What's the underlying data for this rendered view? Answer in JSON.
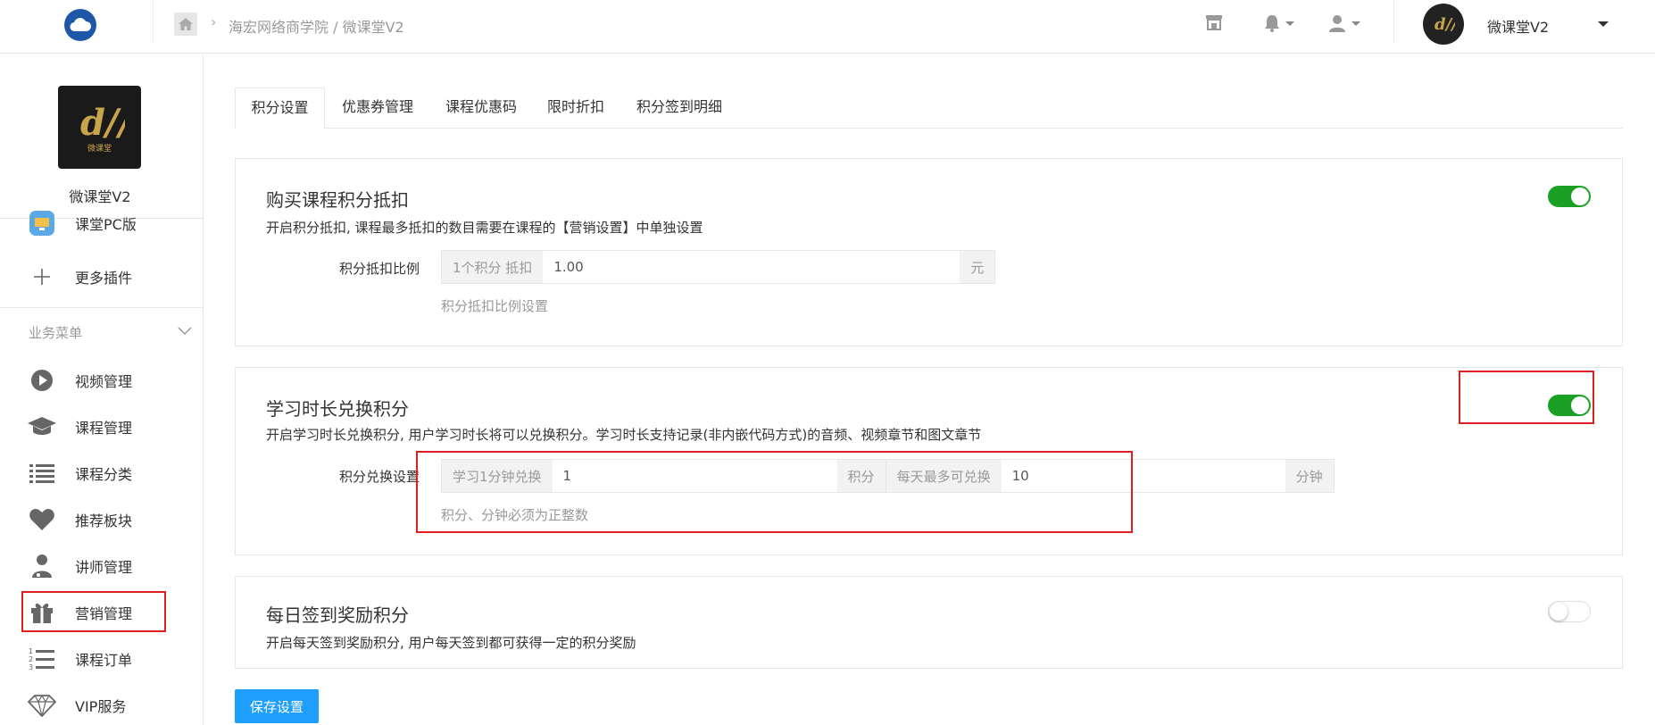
{
  "header": {
    "breadcrumb": "海宏网络商学院 / 微课堂V2",
    "user_name": "微课堂V2"
  },
  "sidebar": {
    "shop_name": "微课堂V2",
    "logo_text": "微课堂",
    "items_top": [
      {
        "label": "课堂PC版",
        "icon": "desktop-icon"
      },
      {
        "label": "更多插件",
        "icon": "plus-icon"
      }
    ],
    "section_title": "业务菜单",
    "items": [
      {
        "label": "视频管理",
        "icon": "play-icon"
      },
      {
        "label": "课程管理",
        "icon": "graduation-cap-icon"
      },
      {
        "label": "课程分类",
        "icon": "list-icon"
      },
      {
        "label": "推荐板块",
        "icon": "heart-icon"
      },
      {
        "label": "讲师管理",
        "icon": "teacher-icon"
      },
      {
        "label": "营销管理",
        "icon": "gift-icon"
      },
      {
        "label": "课程订单",
        "icon": "ordered-list-icon"
      },
      {
        "label": "VIP服务",
        "icon": "diamond-icon"
      }
    ]
  },
  "tabs": [
    "积分设置",
    "优惠券管理",
    "课程优惠码",
    "限时折扣",
    "积分签到明细"
  ],
  "panels": {
    "deduct": {
      "title": "购买课程积分抵扣",
      "desc": "开启积分抵扣, 课程最多抵扣的数目需要在课程的【营销设置】中单独设置",
      "field_label": "积分抵扣比例",
      "prefix": "1个积分 抵扣",
      "value": "1.00",
      "suffix": "元",
      "help": "积分抵扣比例设置",
      "enabled": true
    },
    "study": {
      "title": "学习时长兑换积分",
      "desc": "开启学习时长兑换积分, 用户学习时长将可以兑换积分。学习时长支持记录(非内嵌代码方式)的音频、视频章节和图文章节",
      "field_label": "积分兑换设置",
      "prefix": "学习1分钟兑换",
      "value1": "1",
      "mid": "积分",
      "mid2": "每天最多可兑换",
      "value2": "10",
      "suffix": "分钟",
      "help": "积分、分钟必须为正整数",
      "enabled": true
    },
    "signin": {
      "title": "每日签到奖励积分",
      "desc": "开启每天签到奖励积分, 用户每天签到都可获得一定的积分奖励",
      "enabled": false
    }
  },
  "save_label": "保存设置",
  "colors": {
    "primary": "#1e9fff",
    "switch_on": "#1aa024",
    "highlight": "#e02020"
  }
}
